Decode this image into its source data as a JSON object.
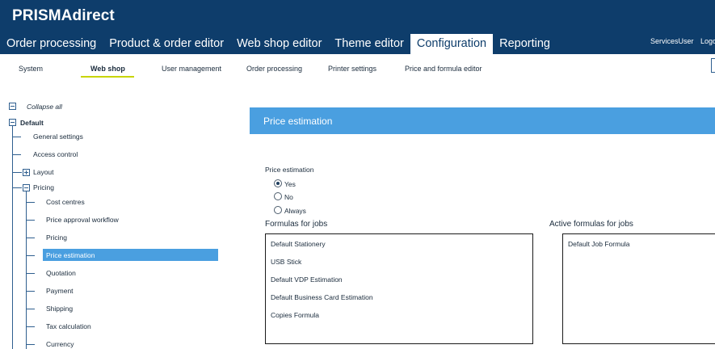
{
  "app": {
    "brand": "PRISMAdirect",
    "user": "ServicesUser",
    "logout": "Logo"
  },
  "main_nav": [
    {
      "label": "Order processing",
      "active": false
    },
    {
      "label": "Product & order editor",
      "active": false
    },
    {
      "label": "Web shop editor",
      "active": false
    },
    {
      "label": "Theme editor",
      "active": false
    },
    {
      "label": "Configuration",
      "active": true
    },
    {
      "label": "Reporting",
      "active": false
    }
  ],
  "sub_nav": [
    {
      "label": "System",
      "active": false
    },
    {
      "label": "Web shop",
      "active": true
    },
    {
      "label": "User management",
      "active": false
    },
    {
      "label": "Order processing",
      "active": false
    },
    {
      "label": "Printer settings",
      "active": false
    },
    {
      "label": "Price and formula editor",
      "active": false
    }
  ],
  "tree": {
    "collapse_all": "Collapse all",
    "root": "Default",
    "items": [
      {
        "label": "General settings"
      },
      {
        "label": "Access control"
      },
      {
        "label": "Layout",
        "expandable": true,
        "expanded": false
      },
      {
        "label": "Pricing",
        "expandable": true,
        "expanded": true
      },
      {
        "label": "Cost centres"
      },
      {
        "label": "Price approval workflow"
      },
      {
        "label": "Pricing"
      },
      {
        "label": "Price estimation",
        "selected": true
      },
      {
        "label": "Quotation"
      },
      {
        "label": "Payment"
      },
      {
        "label": "Shipping"
      },
      {
        "label": "Tax calculation"
      },
      {
        "label": "Currency"
      }
    ]
  },
  "panel": {
    "title": "Price estimation",
    "price_estimation_label": "Price estimation",
    "options": [
      {
        "label": "Yes",
        "selected": true
      },
      {
        "label": "No",
        "selected": false
      },
      {
        "label": "Always",
        "selected": false
      }
    ],
    "formulas_title": "Formulas for jobs",
    "formulas": [
      "Default Stationery",
      "USB Stick",
      "Default VDP Estimation",
      "Default Business Card Estimation",
      "Copies Formula"
    ],
    "active_title": "Active formulas for jobs",
    "active_formulas": [
      "Default Job Formula"
    ]
  },
  "colors": {
    "header_bg": "#0e3d6b",
    "accent_blue": "#4a9fe0",
    "underline": "#c8d400"
  }
}
